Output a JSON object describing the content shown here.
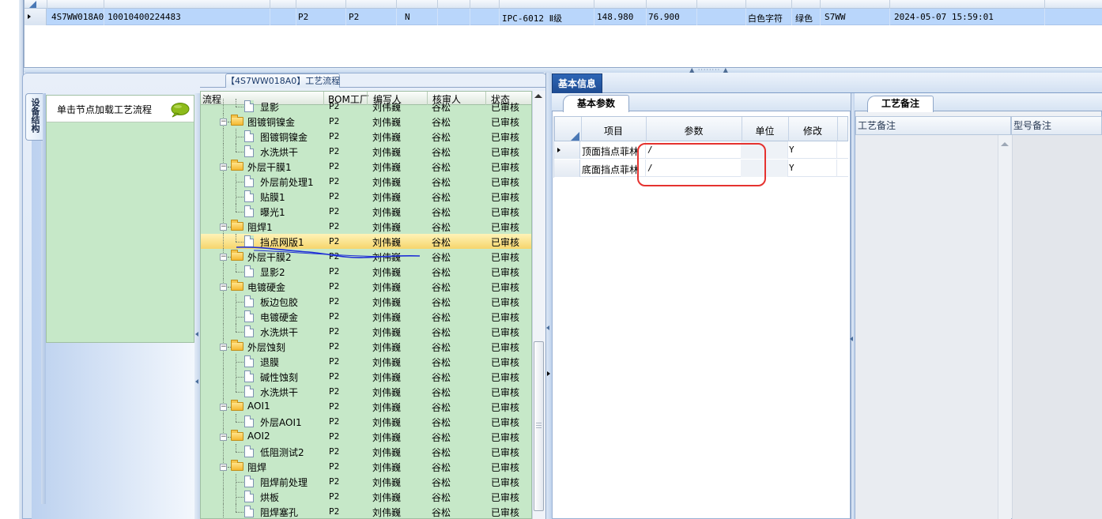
{
  "top_grid": {
    "row": {
      "col1": "4S7WW018A0",
      "col2": "10010400224483",
      "col3": "P2",
      "col4": "P2",
      "col5": "N",
      "col6": "IPC-6012 Ⅱ级",
      "col7": "148.980",
      "col8": "76.900",
      "col9": "白色字符",
      "col10": "绿色",
      "col11": "S7WW",
      "col12": "2024-05-07 15:59:01"
    }
  },
  "left_panel": {
    "vertical_tab": "设备结构",
    "node_hint": "单击节点加载工艺流程"
  },
  "flow": {
    "tab_title": "【4S7WW018A0】工艺流程",
    "headers": {
      "flow": "流程",
      "factory": "BOM工厂",
      "writer": "编写人",
      "reviewer": "核审人",
      "status": "状态"
    },
    "rows": [
      {
        "name": "显影",
        "factory": "P2",
        "writer": "刘伟巍",
        "reviewer": "谷松",
        "status": "已审核",
        "type": "doc",
        "level": 1
      },
      {
        "name": "图镀铜镍金",
        "factory": "P2",
        "writer": "刘伟巍",
        "reviewer": "谷松",
        "status": "已审核",
        "type": "folder",
        "level": 0
      },
      {
        "name": "图镀铜镍金",
        "factory": "P2",
        "writer": "刘伟巍",
        "reviewer": "谷松",
        "status": "已审核",
        "type": "doc",
        "level": 1
      },
      {
        "name": "水洗烘干",
        "factory": "P2",
        "writer": "刘伟巍",
        "reviewer": "谷松",
        "status": "已审核",
        "type": "doc",
        "level": 1
      },
      {
        "name": "外层干膜1",
        "factory": "P2",
        "writer": "刘伟巍",
        "reviewer": "谷松",
        "status": "已审核",
        "type": "folder",
        "level": 0
      },
      {
        "name": "外层前处理1",
        "factory": "P2",
        "writer": "刘伟巍",
        "reviewer": "谷松",
        "status": "已审核",
        "type": "doc",
        "level": 1
      },
      {
        "name": "贴膜1",
        "factory": "P2",
        "writer": "刘伟巍",
        "reviewer": "谷松",
        "status": "已审核",
        "type": "doc",
        "level": 1
      },
      {
        "name": "曝光1",
        "factory": "P2",
        "writer": "刘伟巍",
        "reviewer": "谷松",
        "status": "已审核",
        "type": "doc",
        "level": 1
      },
      {
        "name": "阻焊1",
        "factory": "P2",
        "writer": "刘伟巍",
        "reviewer": "谷松",
        "status": "已审核",
        "type": "folder",
        "level": 0
      },
      {
        "name": "挡点网版1",
        "factory": "P2",
        "writer": "刘伟巍",
        "reviewer": "谷松",
        "status": "已审核",
        "type": "doc",
        "level": 1,
        "selected": true
      },
      {
        "name": "外层干膜2",
        "factory": "P2",
        "writer": "刘伟巍",
        "reviewer": "谷松",
        "status": "已审核",
        "type": "folder",
        "level": 0
      },
      {
        "name": "显影2",
        "factory": "P2",
        "writer": "刘伟巍",
        "reviewer": "谷松",
        "status": "已审核",
        "type": "doc",
        "level": 1
      },
      {
        "name": "电镀硬金",
        "factory": "P2",
        "writer": "刘伟巍",
        "reviewer": "谷松",
        "status": "已审核",
        "type": "folder",
        "level": 0
      },
      {
        "name": "板边包胶",
        "factory": "P2",
        "writer": "刘伟巍",
        "reviewer": "谷松",
        "status": "已审核",
        "type": "doc",
        "level": 1
      },
      {
        "name": "电镀硬金",
        "factory": "P2",
        "writer": "刘伟巍",
        "reviewer": "谷松",
        "status": "已审核",
        "type": "doc",
        "level": 1
      },
      {
        "name": "水洗烘干",
        "factory": "P2",
        "writer": "刘伟巍",
        "reviewer": "谷松",
        "status": "已审核",
        "type": "doc",
        "level": 1
      },
      {
        "name": "外层蚀刻",
        "factory": "P2",
        "writer": "刘伟巍",
        "reviewer": "谷松",
        "status": "已审核",
        "type": "folder",
        "level": 0
      },
      {
        "name": "退膜",
        "factory": "P2",
        "writer": "刘伟巍",
        "reviewer": "谷松",
        "status": "已审核",
        "type": "doc",
        "level": 1
      },
      {
        "name": "碱性蚀刻",
        "factory": "P2",
        "writer": "刘伟巍",
        "reviewer": "谷松",
        "status": "已审核",
        "type": "doc",
        "level": 1
      },
      {
        "name": "水洗烘干",
        "factory": "P2",
        "writer": "刘伟巍",
        "reviewer": "谷松",
        "status": "已审核",
        "type": "doc",
        "level": 1
      },
      {
        "name": "AOI1",
        "factory": "P2",
        "writer": "刘伟巍",
        "reviewer": "谷松",
        "status": "已审核",
        "type": "folder",
        "level": 0
      },
      {
        "name": "外层AOI1",
        "factory": "P2",
        "writer": "刘伟巍",
        "reviewer": "谷松",
        "status": "已审核",
        "type": "doc",
        "level": 1
      },
      {
        "name": "AOI2",
        "factory": "P2",
        "writer": "刘伟巍",
        "reviewer": "谷松",
        "status": "已审核",
        "type": "folder",
        "level": 0
      },
      {
        "name": "低阻测试2",
        "factory": "P2",
        "writer": "刘伟巍",
        "reviewer": "谷松",
        "status": "已审核",
        "type": "doc",
        "level": 1
      },
      {
        "name": "阻焊",
        "factory": "P2",
        "writer": "刘伟巍",
        "reviewer": "谷松",
        "status": "已审核",
        "type": "folder",
        "level": 0
      },
      {
        "name": "阻焊前处理",
        "factory": "P2",
        "writer": "刘伟巍",
        "reviewer": "谷松",
        "status": "已审核",
        "type": "doc",
        "level": 1
      },
      {
        "name": "烘板",
        "factory": "P2",
        "writer": "刘伟巍",
        "reviewer": "谷松",
        "status": "已审核",
        "type": "doc",
        "level": 1
      },
      {
        "name": "阻焊塞孔",
        "factory": "P2",
        "writer": "刘伟巍",
        "reviewer": "谷松",
        "status": "已审核",
        "type": "doc",
        "level": 1
      }
    ]
  },
  "basic_info": {
    "tab_label": "基本信息",
    "params_tab": "基本参数",
    "headers": {
      "item": "项目",
      "param": "参数",
      "unit": "单位",
      "modify": "修改"
    },
    "rows": [
      {
        "item": "顶面挡点菲林",
        "param": "/",
        "unit": "",
        "modify": "Y"
      },
      {
        "item": "底面挡点菲林",
        "param": "/",
        "unit": "",
        "modify": "Y"
      }
    ]
  },
  "craft_notes": {
    "tab_label": "工艺备注",
    "col1": "工艺备注",
    "col2": "型号备注"
  },
  "colors": {
    "tree_bg": "#c6e8c8",
    "selection": "#f6d56c",
    "accent_tab": "#1f4c92",
    "annotation_red": "#e5322f",
    "annotation_blue": "#1f2fd6"
  }
}
